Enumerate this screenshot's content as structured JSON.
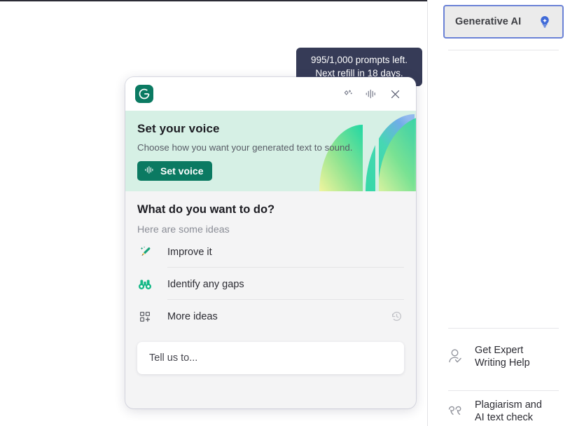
{
  "tooltip": {
    "line1": "995/1,000 prompts left.",
    "line2": "Next refill in 18 days."
  },
  "card": {
    "header": {
      "logo_name": "grammarly-logo",
      "icons": [
        {
          "name": "sparkle-icon",
          "title": "Sparkle"
        },
        {
          "name": "voice-waveform-icon",
          "title": "Voice"
        },
        {
          "name": "close-icon",
          "title": "Close"
        }
      ]
    },
    "voice_banner": {
      "title": "Set your voice",
      "subtitle": "Choose how you want your generated text to sound.",
      "button_label": "Set voice",
      "button_icon": "voice-waveform-icon",
      "bg_color": "#d6f0e5",
      "button_color": "#0b7a62"
    },
    "ideas": {
      "title": "What do you want to do?",
      "subtitle": "Here are some ideas",
      "items": [
        {
          "label": "Improve it",
          "icon": "pencil-sparkle-icon"
        },
        {
          "label": "Identify any gaps",
          "icon": "binoculars-icon"
        },
        {
          "label": "More ideas",
          "icon": "grid-plus-icon",
          "trailing_icon": "history-icon"
        }
      ]
    },
    "prompt": {
      "placeholder": "Tell us to...",
      "value": "Tell us to..."
    }
  },
  "sidebar": {
    "generative_ai": {
      "label": "Generative AI",
      "icon": "lightbulb-icon",
      "accent_color": "#6b82d6",
      "bg_color": "#ebebeb"
    },
    "items": [
      {
        "label": "Get Expert\nWriting Help",
        "line1": "Get Expert",
        "line2": "Writing Help",
        "icon": "person-check-icon"
      },
      {
        "label": "Plagiarism and\nAI text check",
        "line1": "Plagiarism and",
        "line2": "AI text check",
        "icon": "quote-icon"
      }
    ]
  }
}
